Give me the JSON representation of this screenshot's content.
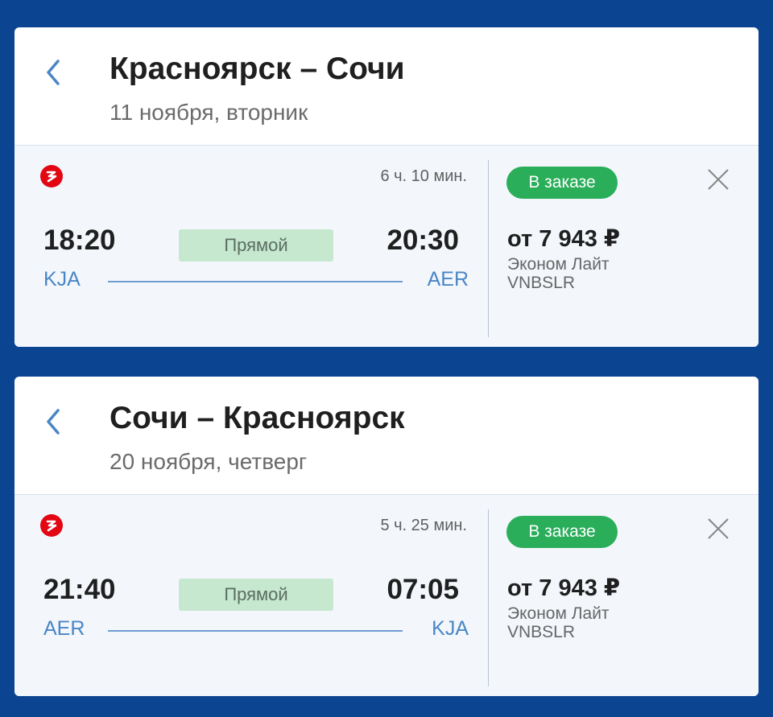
{
  "colors": {
    "background": "#0b4591",
    "accent": "#4a86c6",
    "badge": "#2aae5a",
    "direct_tag": "#c5e8cf",
    "airline_logo": "#e30613"
  },
  "segments": [
    {
      "title": "Красноярск – Сочи",
      "date": "11 ноября, вторник",
      "ticket": {
        "airline_icon": "airline-logo-icon",
        "duration": "6 ч. 10 мин.",
        "departure_time": "18:20",
        "arrival_time": "20:30",
        "departure_code": "KJA",
        "arrival_code": "AER",
        "direct_label": "Прямой",
        "status_badge": "В заказе",
        "price": "от 7 943 ₽",
        "fare_name": "Эконом Лайт",
        "fare_code": "VNBSLR"
      }
    },
    {
      "title": "Сочи – Красноярск",
      "date": "20 ноября, четверг",
      "ticket": {
        "airline_icon": "airline-logo-icon",
        "duration": "5 ч. 25 мин.",
        "departure_time": "21:40",
        "arrival_time": "07:05",
        "departure_code": "AER",
        "arrival_code": "KJA",
        "direct_label": "Прямой",
        "status_badge": "В заказе",
        "price": "от 7 943 ₽",
        "fare_name": "Эконом Лайт",
        "fare_code": "VNBSLR"
      }
    }
  ]
}
